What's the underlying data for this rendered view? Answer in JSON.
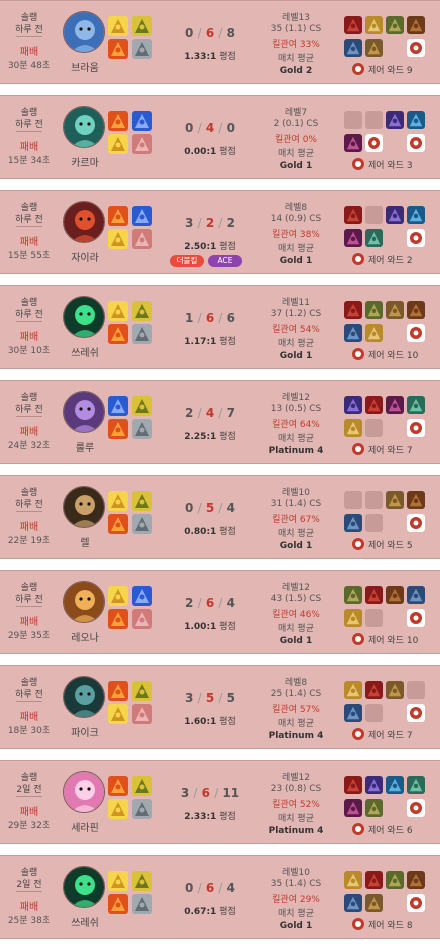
{
  "queue_label": "솔랭",
  "result_label": "패배",
  "ratio_suffix": "평점",
  "ward_prefix": "제어 와드",
  "avg_label": "매치 평균",
  "colors": {
    "card_bg": "#e2b6b3",
    "loss_red": "#c0392b",
    "empty_slot": "#c69b98",
    "double_kill": "#e74c3c",
    "ace": "#8e44ad"
  },
  "matches": [
    {
      "ago": "하루 전",
      "duration": "30분 48초",
      "champion": "브라움",
      "champion_icon": "braum-portrait",
      "spells": [
        "flash-icon",
        "smite-icon",
        "ignite-icon",
        "exhaust-icon"
      ],
      "kills": "0",
      "deaths": "6",
      "assists": "8",
      "ratio": "1.33:1",
      "badges": [],
      "level": "레벨13",
      "cs": "35 (1.1) CS",
      "kp": "킬관여 33%",
      "tier": "Gold 2",
      "wards": "9",
      "items": [
        "item-armor",
        "item-sword",
        "item-helm",
        "item-boots",
        "item-shield",
        "item-helm2",
        "item-ward-totem"
      ]
    },
    {
      "ago": "하루 전",
      "duration": "15분 34초",
      "champion": "카르마",
      "champion_icon": "karma-portrait",
      "spells": [
        "ignite-icon",
        "teleport-icon",
        "flash-icon",
        "heal-icon"
      ],
      "kills": "0",
      "deaths": "4",
      "assists": "0",
      "ratio": "0.00:1",
      "badges": [],
      "level": "레벨7",
      "cs": "2 (0.1) CS",
      "kp": "킬관여 0%",
      "tier": "Gold 1",
      "wards": "3",
      "items": [
        "",
        "",
        "item-wand",
        "item-crystal",
        "item-tome",
        "item-ward-totem",
        "item-ward-totem2"
      ]
    },
    {
      "ago": "하루 전",
      "duration": "15분 55초",
      "champion": "자이라",
      "champion_icon": "zyra-portrait",
      "spells": [
        "ignite-icon",
        "teleport-icon",
        "flash-icon",
        "heal-icon"
      ],
      "kills": "3",
      "deaths": "2",
      "assists": "2",
      "ratio": "2.50:1",
      "badges": [
        "더블킬",
        "ACE"
      ],
      "level": "레벨8",
      "cs": "14 (0.9) CS",
      "kp": "킬관여 38%",
      "tier": "Gold 1",
      "wards": "2",
      "items": [
        "item-armor",
        "",
        "item-wand",
        "item-crystal",
        "item-tome",
        "item-orb",
        "item-ward-totem"
      ]
    },
    {
      "ago": "하루 전",
      "duration": "30분 10초",
      "champion": "쓰레쉬",
      "champion_icon": "thresh-portrait",
      "spells": [
        "flash-icon",
        "smite-icon",
        "ignite-icon",
        "exhaust-icon"
      ],
      "kills": "1",
      "deaths": "6",
      "assists": "6",
      "ratio": "1.17:1",
      "badges": [],
      "level": "레벨11",
      "cs": "37 (1.2) CS",
      "kp": "킬관여 54%",
      "tier": "Gold 1",
      "wards": "10",
      "items": [
        "item-armor",
        "item-helm",
        "item-helm2",
        "item-boots",
        "item-shield",
        "item-sword",
        "item-ward-totem"
      ]
    },
    {
      "ago": "하루 전",
      "duration": "24분 32초",
      "champion": "룰루",
      "champion_icon": "lulu-portrait",
      "spells": [
        "teleport-icon",
        "smite-icon",
        "ignite-icon",
        "exhaust-icon"
      ],
      "kills": "2",
      "deaths": "4",
      "assists": "7",
      "ratio": "2.25:1",
      "badges": [],
      "level": "레벨12",
      "cs": "13 (0.5) CS",
      "kp": "킬관여 64%",
      "tier": "Platinum 4",
      "wards": "7",
      "items": [
        "item-wand",
        "item-armor",
        "item-tome",
        "item-orb",
        "item-sword",
        "",
        "item-ward-totem"
      ]
    },
    {
      "ago": "하루 전",
      "duration": "22분 19초",
      "champion": "렐",
      "champion_icon": "rell-portrait",
      "spells": [
        "flash-icon",
        "smite-icon",
        "ignite-icon",
        "exhaust-icon"
      ],
      "kills": "0",
      "deaths": "5",
      "assists": "4",
      "ratio": "0.80:1",
      "badges": [],
      "level": "레벨10",
      "cs": "31 (1.4) CS",
      "kp": "킬관여 67%",
      "tier": "Gold 1",
      "wards": "5",
      "items": [
        "",
        "",
        "item-helm2",
        "item-boots",
        "item-shield",
        "",
        "item-ward-totem"
      ]
    },
    {
      "ago": "하루 전",
      "duration": "29분 35초",
      "champion": "레오나",
      "champion_icon": "leona-portrait",
      "spells": [
        "flash-icon",
        "teleport-icon",
        "ignite-icon",
        "heal-icon"
      ],
      "kills": "2",
      "deaths": "6",
      "assists": "4",
      "ratio": "1.00:1",
      "badges": [],
      "level": "레벨12",
      "cs": "43 (1.5) CS",
      "kp": "킬관여 46%",
      "tier": "Gold 1",
      "wards": "10",
      "items": [
        "item-helm",
        "item-armor",
        "item-boots",
        "item-shield",
        "item-sword",
        "",
        "item-ward-totem"
      ]
    },
    {
      "ago": "하루 전",
      "duration": "18분 30초",
      "champion": "파이크",
      "champion_icon": "pyke-portrait",
      "spells": [
        "ignite-icon",
        "smite-icon",
        "flash-icon",
        "heal-icon"
      ],
      "kills": "3",
      "deaths": "5",
      "assists": "5",
      "ratio": "1.60:1",
      "badges": [],
      "level": "레벨8",
      "cs": "25 (1.4) CS",
      "kp": "킬관여 57%",
      "tier": "Platinum 4",
      "wards": "7",
      "items": [
        "item-sword",
        "item-armor",
        "item-helm2",
        "",
        "item-shield",
        "",
        "item-ward-totem"
      ]
    },
    {
      "ago": "2일 전",
      "duration": "29분 32초",
      "champion": "세라핀",
      "champion_icon": "seraphine-portrait",
      "spells": [
        "ignite-icon",
        "smite-icon",
        "flash-icon",
        "exhaust-icon"
      ],
      "kills": "3",
      "deaths": "6",
      "assists": "11",
      "ratio": "2.33:1",
      "badges": [],
      "level": "레벨12",
      "cs": "23 (0.8) CS",
      "kp": "킬관여 52%",
      "tier": "Platinum 4",
      "wards": "6",
      "items": [
        "item-armor",
        "item-wand",
        "item-crystal",
        "item-orb",
        "item-tome",
        "item-helm",
        "item-ward-totem"
      ]
    },
    {
      "ago": "2일 전",
      "duration": "25분 38초",
      "champion": "쓰레쉬",
      "champion_icon": "thresh-portrait",
      "spells": [
        "flash-icon",
        "smite-icon",
        "ignite-icon",
        "exhaust-icon"
      ],
      "kills": "0",
      "deaths": "6",
      "assists": "4",
      "ratio": "0.67:1",
      "badges": [],
      "level": "레벨10",
      "cs": "35 (1.4) CS",
      "kp": "킬관여 29%",
      "tier": "Gold 1",
      "wards": "8",
      "items": [
        "item-sword",
        "item-armor",
        "item-helm",
        "item-boots",
        "item-shield",
        "item-helm2",
        "item-ward-totem"
      ]
    }
  ]
}
